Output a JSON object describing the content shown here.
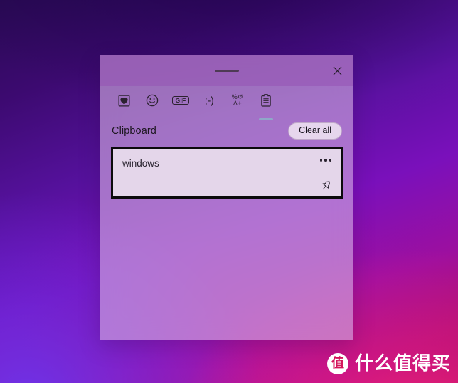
{
  "window": {
    "drag_handle_name": "drag-handle",
    "close_label": "×"
  },
  "tabs": [
    {
      "id": "stickers",
      "icon": "sticker-heart-icon",
      "label": "",
      "selected": false
    },
    {
      "id": "emoji",
      "icon": "emoji-smiley-icon",
      "label": "",
      "selected": false
    },
    {
      "id": "gif",
      "icon": "gif-icon",
      "label": "GIF",
      "selected": false
    },
    {
      "id": "kaomoji",
      "icon": "kaomoji-icon",
      "label": ";-)",
      "selected": false
    },
    {
      "id": "symbols",
      "icon": "symbols-icon",
      "label": "%↺Δ+",
      "symbol_top": "%↺",
      "symbol_bottom": "Δ+",
      "selected": false
    },
    {
      "id": "clipboard",
      "icon": "clipboard-icon",
      "label": "",
      "selected": true
    }
  ],
  "section": {
    "title": "Clipboard",
    "clear_all_label": "Clear all"
  },
  "clipboard_items": [
    {
      "text": "windows",
      "more_label": "•••",
      "pin_label": "Pin"
    }
  ],
  "watermark": {
    "badge_char": "值",
    "text": "什么值得买"
  },
  "colors": {
    "accent_tab_indicator": "#8fa8c8",
    "panel_bg": "#d4afe2",
    "titlebar_bg": "#9654b4",
    "card_bg": "#e4d6ea",
    "card_border": "#0b0a0c",
    "clear_all_bg": "#e6d6ed",
    "watermark_red": "#d4145a"
  }
}
